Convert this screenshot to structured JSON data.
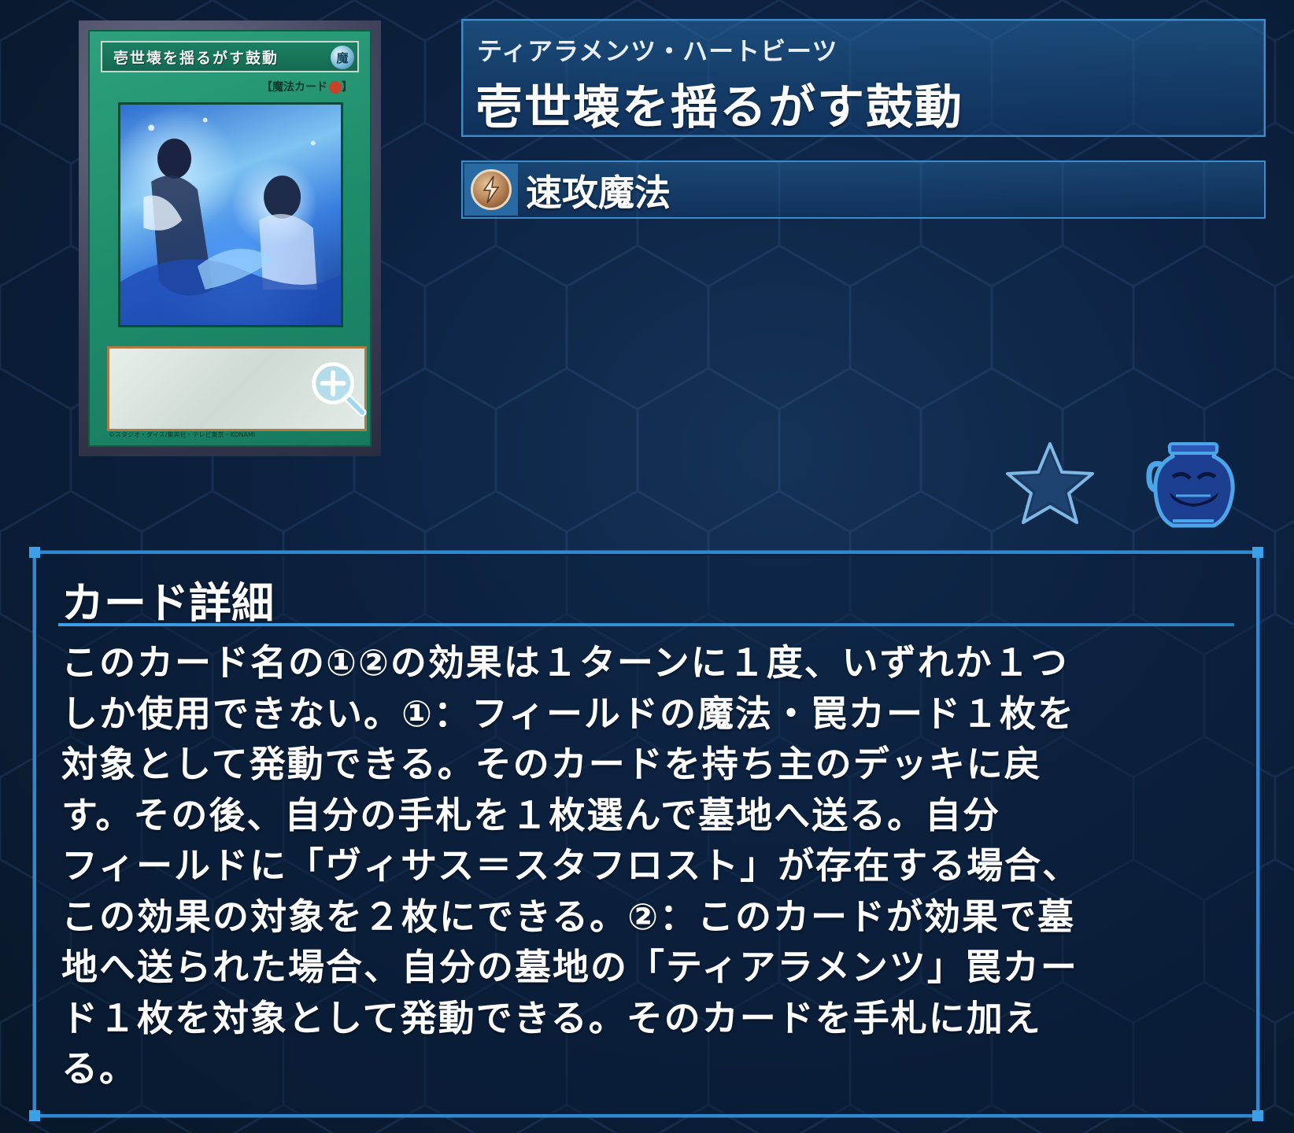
{
  "card_image": {
    "name_text": "壱世壊を揺るがす鼓動",
    "attribute_text": "魔",
    "type_line": "【魔法カード",
    "type_line_suffix": "】",
    "footer_text": "©スタジオ・ダイス/集英社・テレビ東京・KONAMI"
  },
  "header": {
    "ruby": "ティアラメンツ・ハートビーツ",
    "title": "壱世壊を揺るがす鼓動"
  },
  "type": {
    "label": "速攻魔法",
    "icon": "quick-play-spell-icon"
  },
  "actions": {
    "favorite_icon": "star-icon",
    "pot_icon": "pot-of-greed-icon"
  },
  "detail": {
    "heading": "カード詳細",
    "lines": [
      "このカード名の①②の効果は１ターンに１度、いずれか１つ",
      "しか使用できない。①：フィールドの魔法・罠カード１枚を",
      "対象として発動できる。そのカードを持ち主のデッキに戻",
      "す。その後、自分の手札を１枚選んで墓地へ送る。自分",
      "フィールドに「ヴィサス＝スタフロスト」が存在する場合、",
      "この効果の対象を２枚にできる。②：このカードが効果で墓",
      "地へ送られた場合、自分の墓地の「ティアラメンツ」罠カー",
      "ド１枚を対象として発動できる。そのカードを手札に加え",
      "る。"
    ]
  },
  "colors": {
    "background": "#0b1d33",
    "panel_border": "#3a8ccc",
    "detail_border": "#2d8ad0",
    "card_green": "#1e8c6b"
  }
}
